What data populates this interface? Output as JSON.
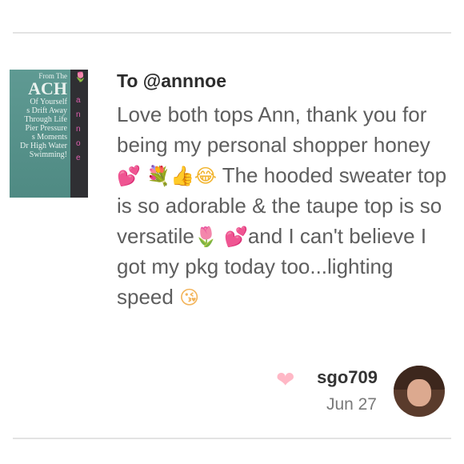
{
  "thumbnail": {
    "lines": [
      "From The",
      "ACH",
      "Of Yourself",
      "s Drift Away",
      "Through Life",
      "Pier Pressure",
      "s Moments",
      "Dr High Water",
      "Swimming!"
    ],
    "side_text": "annoe"
  },
  "comment": {
    "recipient": "To @annnoe",
    "segments": [
      "Love both tops Ann, thank you for being my personal shopper honey",
      "The hooded sweater top is so adorable & the taupe top is so versatile",
      "and I can't believe I got my pkg today too...lighting speed"
    ],
    "emoji": {
      "heart": "💕",
      "bouquet": "💐",
      "thumbs": "👍",
      "laugh": "😂",
      "tulip": "🌷",
      "kiss": "😘"
    }
  },
  "footer": {
    "username": "sgo709",
    "date": "Jun 27",
    "like_icon": "heart-icon"
  },
  "colors": {
    "heart": "#ffb8c6",
    "text": "#5e5e5e",
    "divider": "#e3e3e3"
  }
}
